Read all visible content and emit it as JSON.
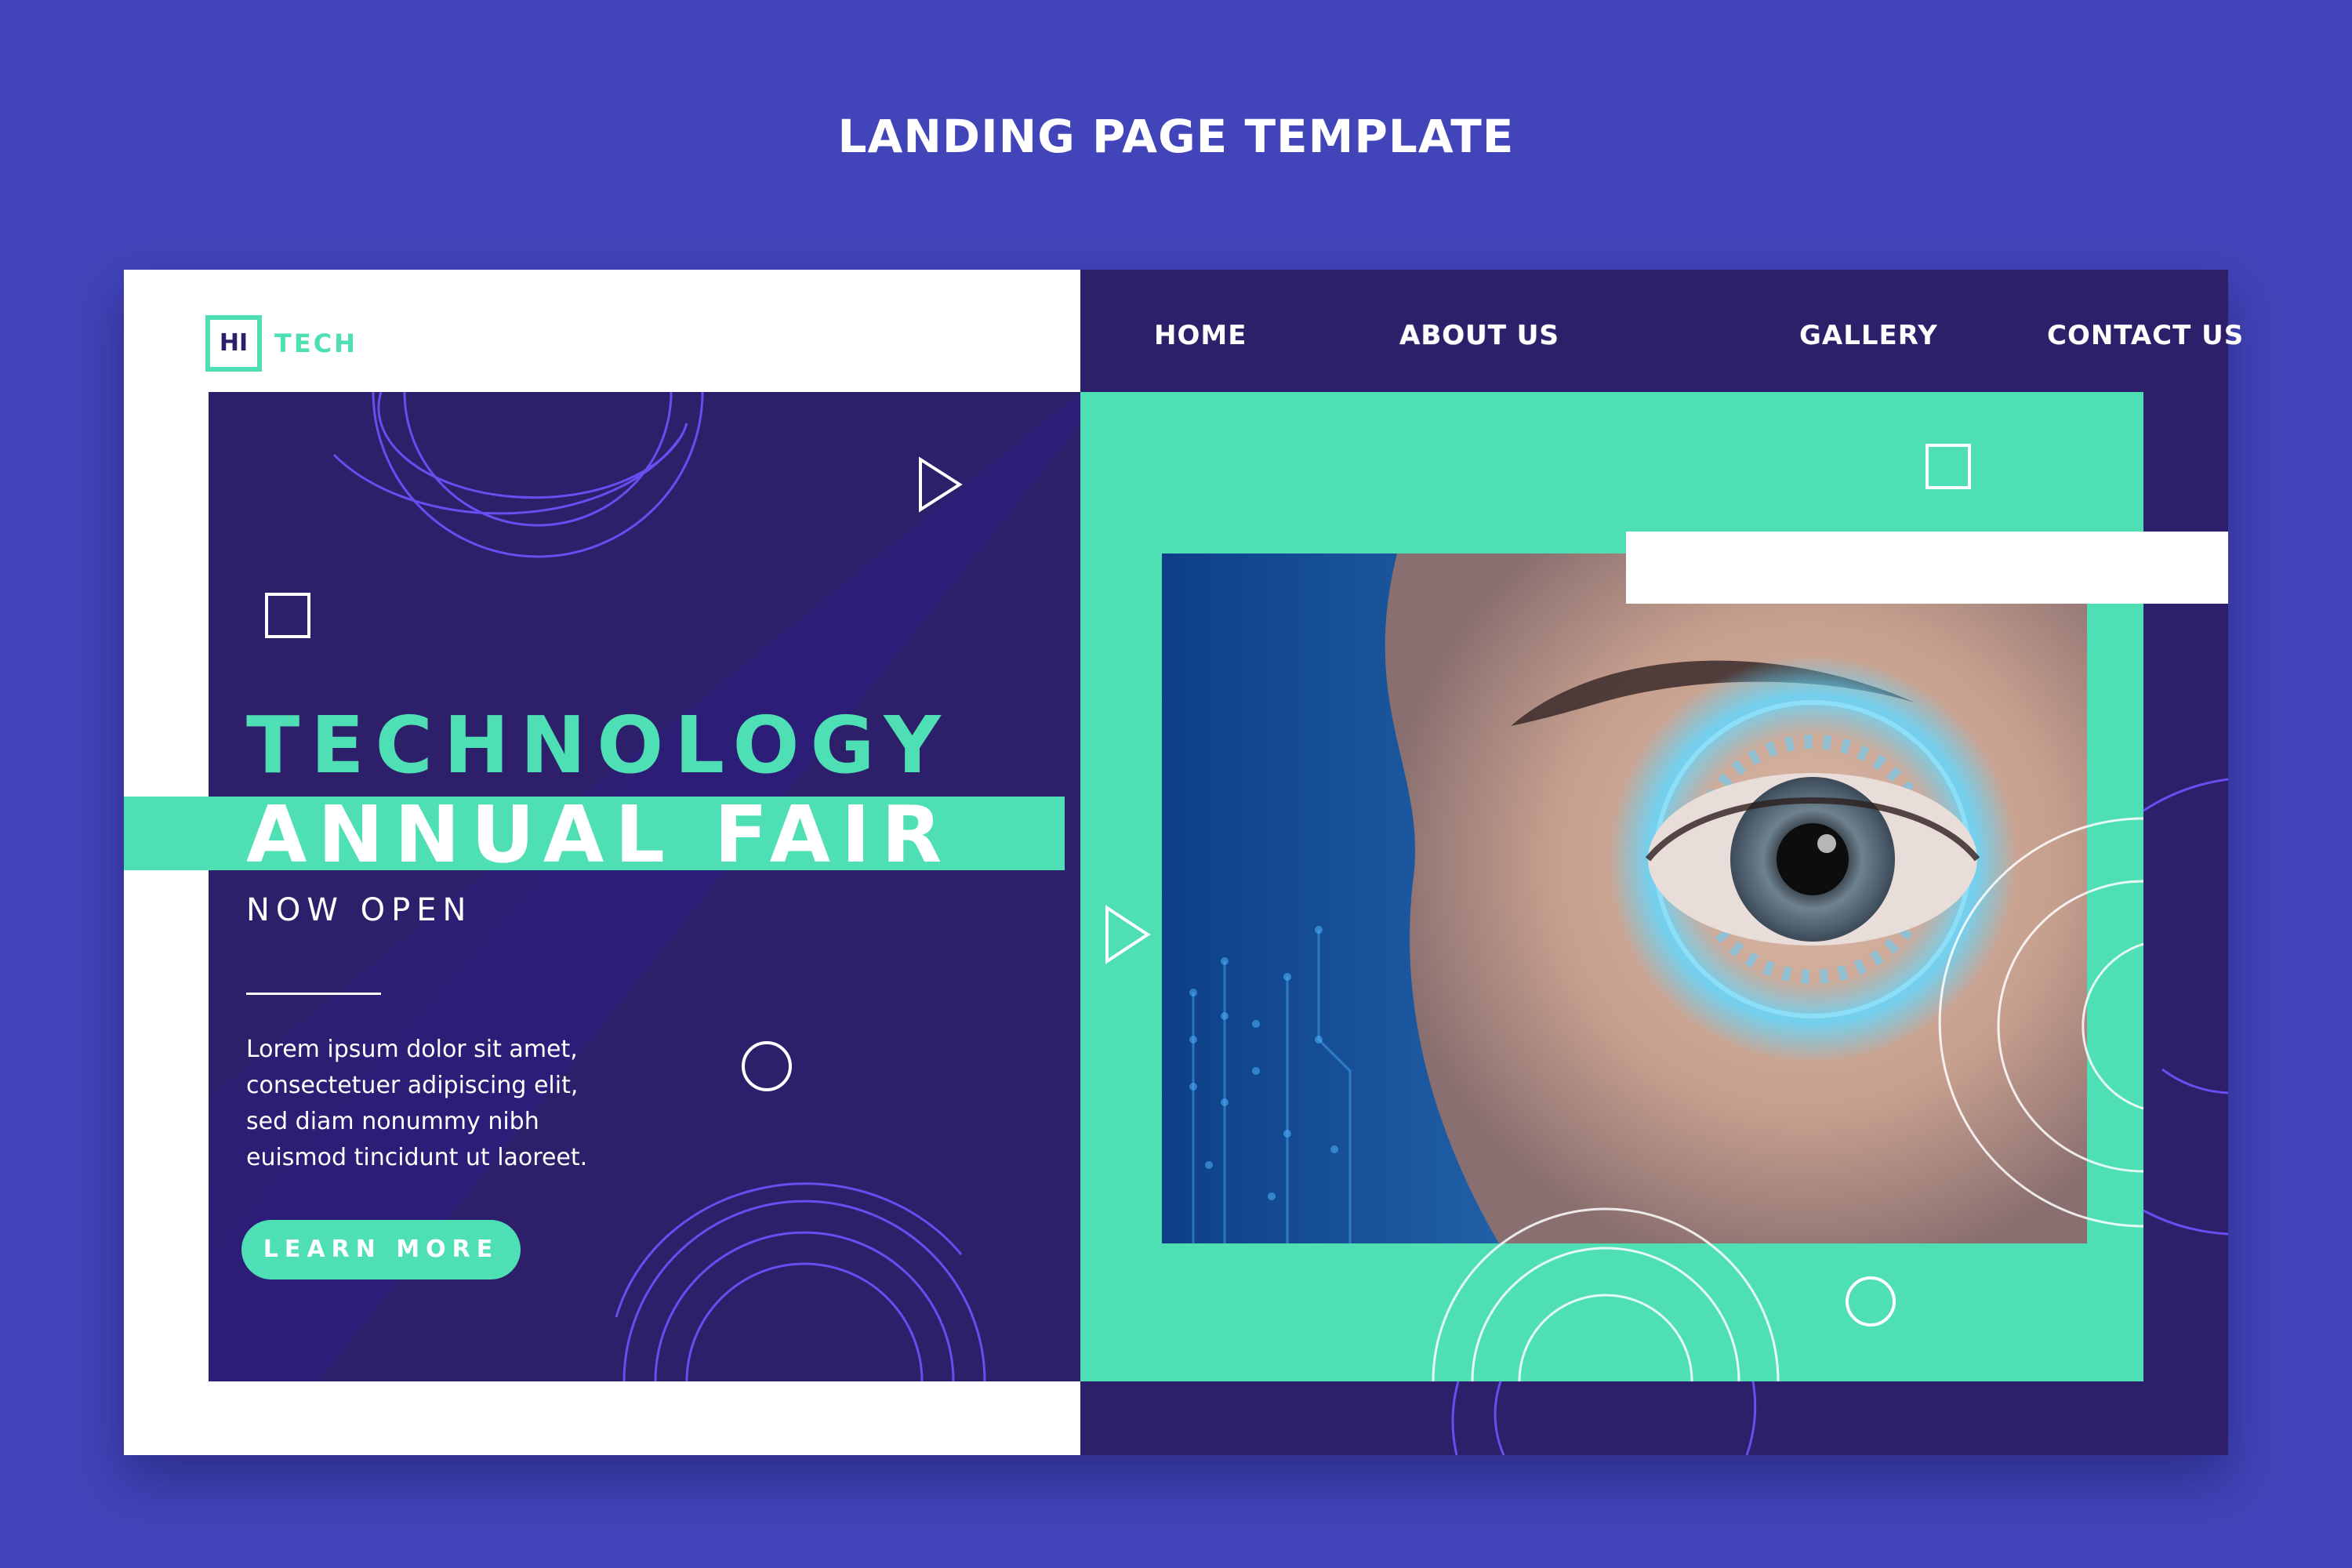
{
  "page_title": "LANDING PAGE TEMPLATE",
  "logo": {
    "box_text": "HI",
    "text": "TECH"
  },
  "nav": {
    "items": [
      "HOME",
      "ABOUT US",
      "GALLERY",
      "CONTACT US"
    ],
    "active": "ABOUT US"
  },
  "hero": {
    "headline_line1": "TECHNOLOGY",
    "headline_line2": "ANNUAL FAIR",
    "subheadline": "NOW OPEN",
    "body_lines": [
      "Lorem ipsum dolor sit amet,",
      "consectetuer adipiscing elit,",
      "sed diam nonummy nibh",
      "euismod tincidunt ut laoreet."
    ],
    "cta_label": "LEARN MORE"
  },
  "colors": {
    "background": "#4244b9",
    "dark_purple": "#2e1f6b",
    "teal": "#4ee0b4",
    "white": "#ffffff",
    "line_purple": "#6a4df0"
  },
  "icons": [
    "play-triangle-icon",
    "square-outline-icon",
    "circle-outline-icon",
    "concentric-arcs-icon"
  ]
}
